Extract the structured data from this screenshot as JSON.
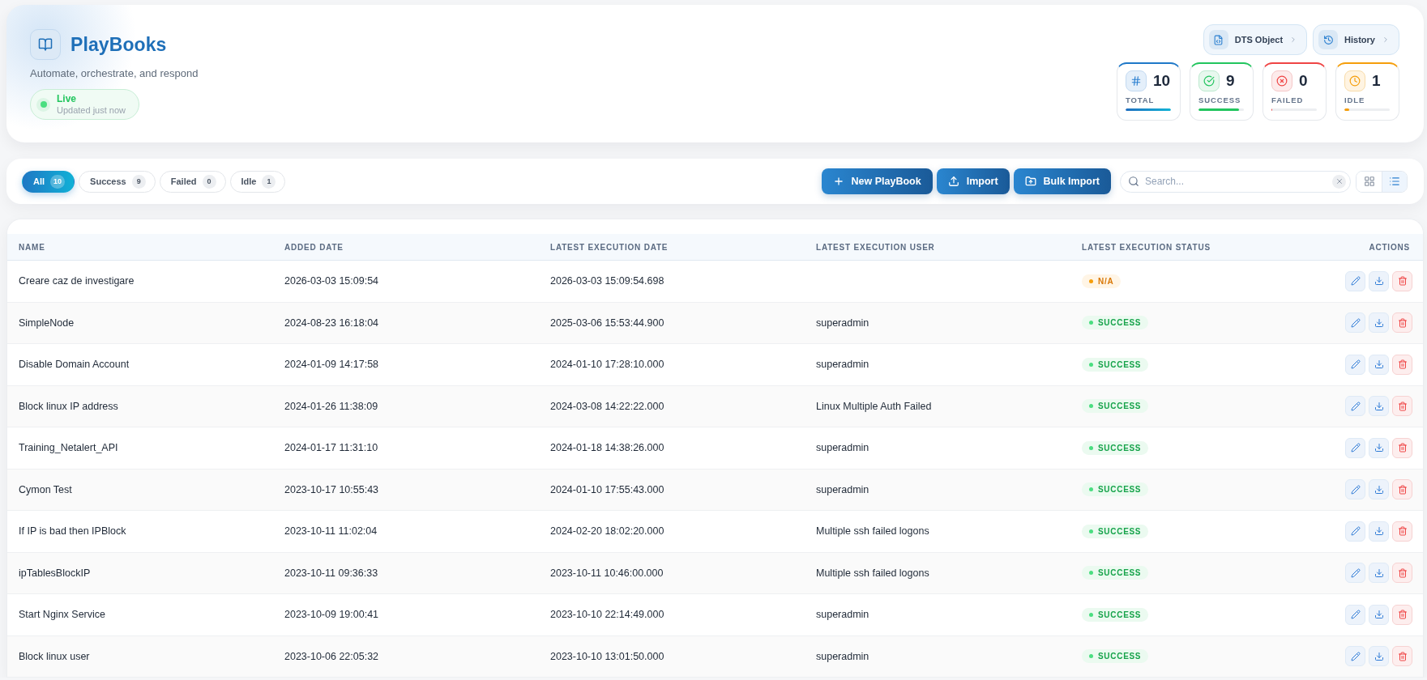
{
  "header": {
    "title": "PlayBooks",
    "subtitle": "Automate, orchestrate, and respond",
    "live": {
      "label": "Live",
      "detail": "Updated just now"
    },
    "links": [
      {
        "kind": "dts",
        "label": "DTS Object"
      },
      {
        "kind": "history",
        "label": "History"
      }
    ],
    "stats": [
      {
        "kind": "total",
        "value": "10",
        "label": "TOTAL",
        "level": 1
      },
      {
        "kind": "success",
        "value": "9",
        "label": "SUCCESS",
        "level": 0.9
      },
      {
        "kind": "failed",
        "value": "0",
        "label": "FAILED",
        "level": 0
      },
      {
        "kind": "idle",
        "value": "1",
        "label": "IDLE",
        "level": 0.1
      }
    ]
  },
  "toolbar": {
    "filters": [
      {
        "label": "All",
        "count": "10",
        "selected": true
      },
      {
        "label": "Success",
        "count": "9",
        "selected": false
      },
      {
        "label": "Failed",
        "count": "0",
        "selected": false
      },
      {
        "label": "Idle",
        "count": "1",
        "selected": false
      }
    ],
    "actions": [
      {
        "kind": "new",
        "label": "New PlayBook"
      },
      {
        "kind": "import",
        "label": "Import"
      },
      {
        "kind": "bulk",
        "label": "Bulk Import"
      }
    ],
    "search": {
      "placeholder": "Search..."
    },
    "view_modes": [
      {
        "kind": "grid",
        "selected": false
      },
      {
        "kind": "list",
        "selected": true
      }
    ]
  },
  "table": {
    "columns": [
      "NAME",
      "ADDED DATE",
      "LATEST EXECUTION DATE",
      "LATEST EXECUTION USER",
      "LATEST EXECUTION STATUS",
      "ACTIONS"
    ],
    "rows": [
      {
        "name": "Creare caz de investigare",
        "added": "2026-03-03 15:09:54",
        "executed": "2026-03-03 15:09:54.698",
        "status": {
          "label": "N/A",
          "kind": "pending"
        }
      },
      {
        "name": "SimpleNode",
        "added": "2024-08-23 16:18:04",
        "executed": "2025-03-06 15:53:44.900",
        "user": "superadmin",
        "status": {
          "label": "SUCCESS",
          "kind": "success"
        }
      },
      {
        "name": "Disable Domain Account",
        "added": "2024-01-09 14:17:58",
        "executed": "2024-01-10 17:28:10.000",
        "user": "superadmin",
        "status": {
          "label": "SUCCESS",
          "kind": "success"
        }
      },
      {
        "name": "Block linux IP address",
        "added": "2024-01-26 11:38:09",
        "executed": "2024-03-08 14:22:22.000",
        "user": "Linux Multiple Auth Failed",
        "status": {
          "label": "SUCCESS",
          "kind": "success"
        }
      },
      {
        "name": "Training_Netalert_API",
        "added": "2024-01-17 11:31:10",
        "executed": "2024-01-18 14:38:26.000",
        "user": "superadmin",
        "status": {
          "label": "SUCCESS",
          "kind": "success"
        }
      },
      {
        "name": "Cymon Test",
        "added": "2023-10-17 10:55:43",
        "executed": "2024-01-10 17:55:43.000",
        "user": "superadmin",
        "status": {
          "label": "SUCCESS",
          "kind": "success"
        }
      },
      {
        "name": "If IP is bad then IPBlock",
        "added": "2023-10-11 11:02:04",
        "executed": "2024-02-20 18:02:20.000",
        "user": "Multiple ssh failed logons",
        "status": {
          "label": "SUCCESS",
          "kind": "success"
        }
      },
      {
        "name": "ipTablesBlockIP",
        "added": "2023-10-11 09:36:33",
        "executed": "2023-10-11 10:46:00.000",
        "user": "Multiple ssh failed logons",
        "status": {
          "label": "SUCCESS",
          "kind": "success"
        }
      },
      {
        "name": "Start Nginx Service",
        "added": "2023-10-09 19:00:41",
        "executed": "2023-10-10 22:14:49.000",
        "user": "superadmin",
        "status": {
          "label": "SUCCESS",
          "kind": "success"
        }
      },
      {
        "name": "Block linux user",
        "added": "2023-10-06 22:05:32",
        "executed": "2023-10-10 13:01:50.000",
        "user": "superadmin",
        "status": {
          "label": "SUCCESS",
          "kind": "success"
        }
      }
    ]
  }
}
